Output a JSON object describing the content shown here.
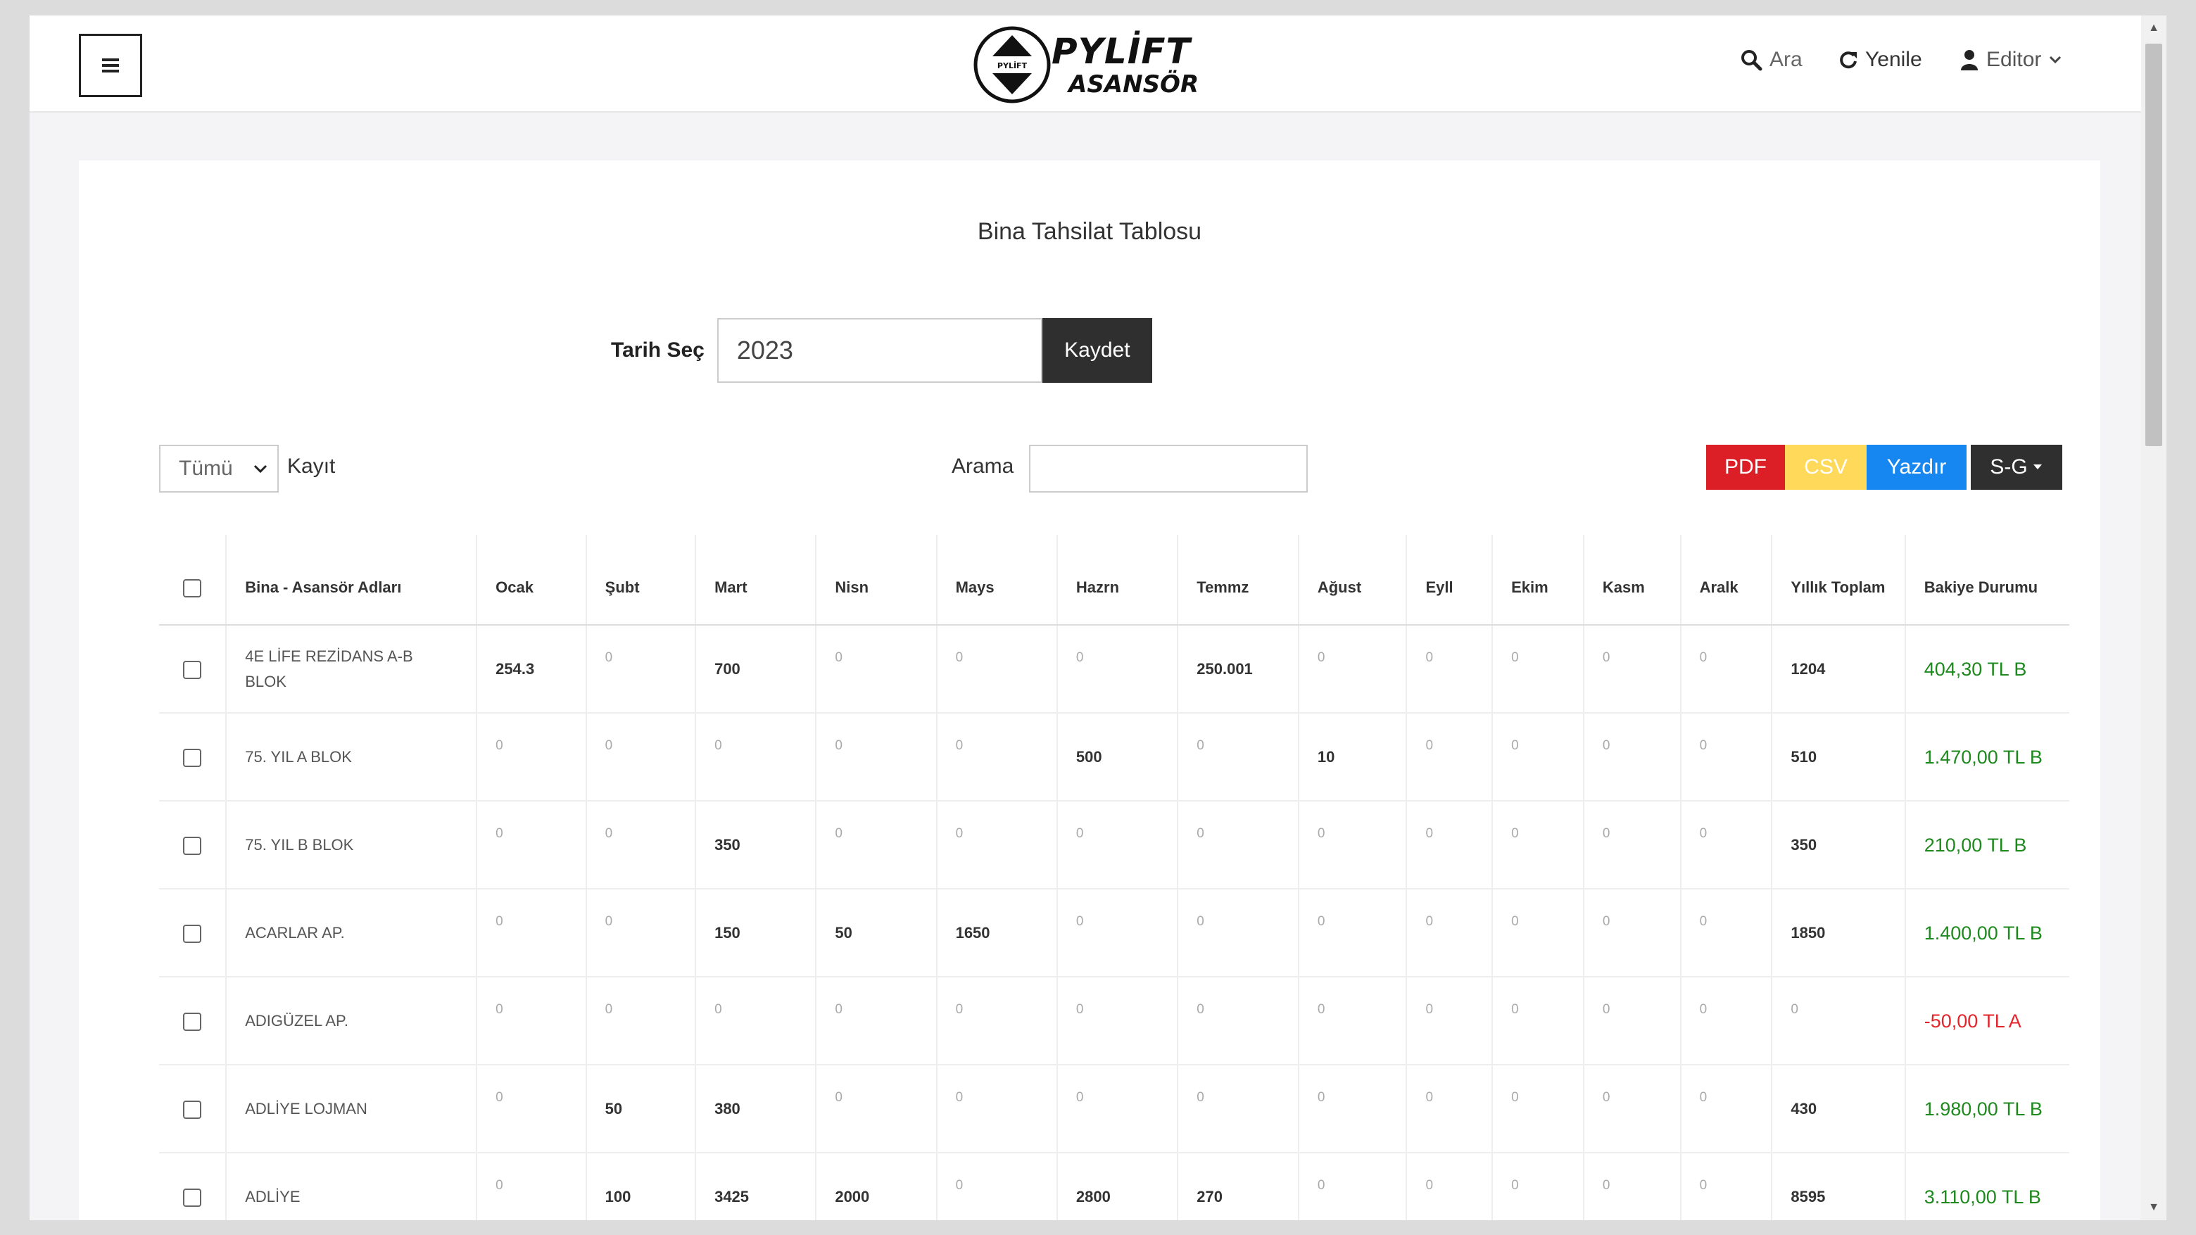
{
  "header": {
    "brand_line1": "PYLİFT",
    "brand_line2": "ASANSÖR",
    "emblem_text": "PYLİFT",
    "search_label": "Ara",
    "refresh_label": "Yenile",
    "user_label": "Editor"
  },
  "page": {
    "title": "Bina Tahsilat Tablosu",
    "date_label": "Tarih Seç",
    "date_value": "2023",
    "save_label": "Kaydet",
    "length_value": "Tümü",
    "length_suffix": "Kayıt",
    "search_label": "Arama",
    "buttons": {
      "pdf": "PDF",
      "csv": "CSV",
      "print": "Yazdır",
      "sg": "S-G"
    }
  },
  "table": {
    "headers": [
      "Bina - Asansör Adları",
      "Ocak",
      "Şubt",
      "Mart",
      "Nisn",
      "Mays",
      "Hazrn",
      "Temmz",
      "Ağust",
      "Eyll",
      "Ekim",
      "Kasm",
      "Aralk",
      "Yıllık Toplam",
      "Bakiye Durumu"
    ],
    "rows": [
      {
        "name": "4E LİFE REZİDANS A-B BLOK",
        "months": [
          "254.3",
          "0",
          "700",
          "0",
          "0",
          "0",
          "250.001",
          "0",
          "0",
          "0",
          "0",
          "0"
        ],
        "total": "1204",
        "balance": "404,30 TL B",
        "balance_type": "pos"
      },
      {
        "name": "75. YIL A BLOK",
        "months": [
          "0",
          "0",
          "0",
          "0",
          "0",
          "500",
          "0",
          "10",
          "0",
          "0",
          "0",
          "0"
        ],
        "total": "510",
        "balance": "1.470,00 TL B",
        "balance_type": "pos"
      },
      {
        "name": "75. YIL B BLOK",
        "months": [
          "0",
          "0",
          "350",
          "0",
          "0",
          "0",
          "0",
          "0",
          "0",
          "0",
          "0",
          "0"
        ],
        "total": "350",
        "balance": "210,00 TL B",
        "balance_type": "pos"
      },
      {
        "name": "ACARLAR AP.",
        "months": [
          "0",
          "0",
          "150",
          "50",
          "1650",
          "0",
          "0",
          "0",
          "0",
          "0",
          "0",
          "0"
        ],
        "total": "1850",
        "balance": "1.400,00 TL B",
        "balance_type": "pos"
      },
      {
        "name": "ADIGÜZEL AP.",
        "months": [
          "0",
          "0",
          "0",
          "0",
          "0",
          "0",
          "0",
          "0",
          "0",
          "0",
          "0",
          "0"
        ],
        "total": "0",
        "balance": "-50,00 TL A",
        "balance_type": "neg"
      },
      {
        "name": "ADLİYE LOJMAN",
        "months": [
          "0",
          "50",
          "380",
          "0",
          "0",
          "0",
          "0",
          "0",
          "0",
          "0",
          "0",
          "0"
        ],
        "total": "430",
        "balance": "1.980,00 TL B",
        "balance_type": "pos"
      },
      {
        "name": "ADLİYE",
        "months": [
          "0",
          "100",
          "3425",
          "2000",
          "0",
          "2800",
          "270",
          "0",
          "0",
          "0",
          "0",
          "0"
        ],
        "total": "8595",
        "balance": "3.110,00 TL B",
        "balance_type": "pos"
      }
    ]
  },
  "colors": {
    "pdf": "#dc1f26",
    "csv": "#fed95a",
    "print": "#1686f0",
    "dark": "#2f2f2f",
    "positive": "#1e8a1e",
    "negative": "#e3242b"
  }
}
